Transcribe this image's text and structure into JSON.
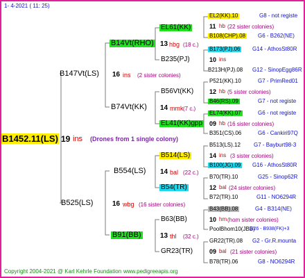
{
  "header": {
    "date": "1-  4-2021 ( 11: 25)"
  },
  "footer": {
    "copyright": "Copyright 2004-2021 @ Karl Kehrle Foundation",
    "url": "www.pedigreeapis.org"
  },
  "root": {
    "name": "B1452.11(LS)",
    "sisters": "19",
    "unit": "ins",
    "note": "(Drones from 1 single colony)"
  },
  "gen1": [
    {
      "name": "B147Vt(LS)",
      "sisters": "16",
      "unit": "ins",
      "note": "(2 sister colonies)"
    },
    {
      "name": "B525(LS)",
      "sisters": "16",
      "unit": "wbg",
      "note": "(16 sister colonies)"
    }
  ],
  "gen2": [
    {
      "name": "B14Vt(RHO)",
      "sisters": "13",
      "unit": "hbg",
      "note": "(18 c.)"
    },
    {
      "name": "B74Vt(KK)",
      "sisters": "14",
      "unit": "mmk",
      "note": "(7 c.)"
    },
    {
      "name": "B554(LS)",
      "sisters": "14",
      "unit": "bal",
      "note": "(22 c.)"
    },
    {
      "name": "B91(BB)",
      "sisters": "13",
      "unit": "thl",
      "note": "(32 c.)"
    }
  ],
  "gen3": [
    {
      "name": "EL61(KK)"
    },
    {
      "name": "B235(PJ)"
    },
    {
      "name": "B56Vt(KK)"
    },
    {
      "name": "EL41(KK)gpp"
    },
    {
      "name": "B514(LS)"
    },
    {
      "name": "B54(TR)"
    },
    {
      "name": "B63(BB)"
    },
    {
      "name": "GR23(TR)"
    }
  ],
  "gen4": [
    {
      "name": "EL2(KK).10",
      "right": "G8 - not registe"
    },
    {
      "sisters": "11",
      "unit": "hb",
      "note": "(22 sister colonies)"
    },
    {
      "name": "B108(CHP).08",
      "right": "G6 - B262(NE)"
    },
    {
      "name": "B173(PJ).06",
      "right": "G14 - AthosSt80R"
    },
    {
      "sisters": "10",
      "unit": "ins",
      "note": ""
    },
    {
      "name": "B213H(PJ).08",
      "right": "G12 - SinopEgg86R"
    },
    {
      "name": "P521(KK).10",
      "right": "G7 - PrimRed01"
    },
    {
      "sisters": "12",
      "unit": "hb",
      "note": "(5 sister colonies)"
    },
    {
      "name": "B46(RS).09",
      "right": "G7 - not registe"
    },
    {
      "name": "EL74(KK).07",
      "right": "G6 - not registe"
    },
    {
      "sisters": "09",
      "unit": "hb",
      "note": "(16 sister colonies)"
    },
    {
      "name": "B351(CS).06",
      "right": "G6 - Cankiri97Q"
    },
    {
      "name": "B513(LS).12",
      "right": "G7 - Bayburt98-3"
    },
    {
      "sisters": "14",
      "unit": "ins",
      "note": "(3 sister colonies)"
    },
    {
      "name": "B100(JG).09",
      "right": "G16 - AthosSt80R"
    },
    {
      "name": "B70(TR).10",
      "right": "G25 - Sinop62R"
    },
    {
      "sisters": "12",
      "unit": "bal",
      "note": "(24 sister colonies)"
    },
    {
      "name": "B72(TR).10",
      "right": "G11 - NO6294R"
    },
    {
      "name": "B43(BB).08",
      "right": "G4 - B314(NE)"
    },
    {
      "sisters": "10",
      "unit": "hm",
      "note": "(hom sister colonies)"
    },
    {
      "name": "PoolBhom10(JBB)",
      "right": "G26 - B938(FK)+3"
    },
    {
      "name": "GR22(TR).08",
      "right": "G2 - Gr.R.mounta"
    },
    {
      "sisters": "09",
      "unit": "bal",
      "note": "(21 sister colonies)"
    },
    {
      "name": "B78(TR).06",
      "right": "G8 - NO6294R"
    }
  ]
}
